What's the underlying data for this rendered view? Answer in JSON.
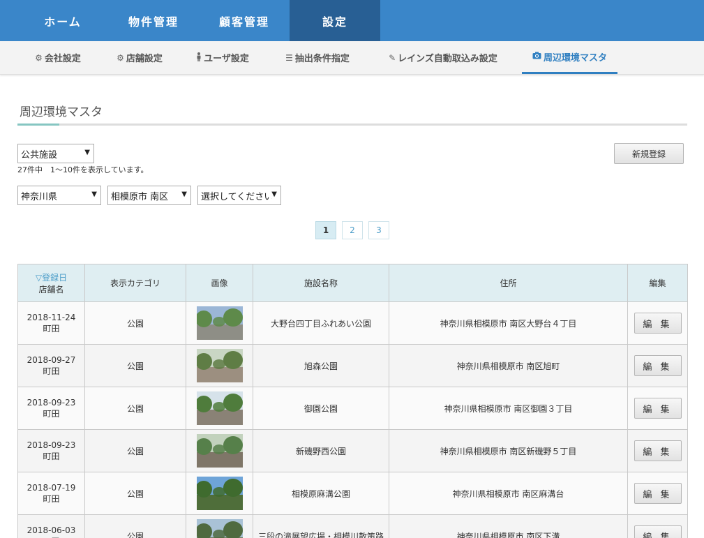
{
  "topnav": {
    "items": [
      {
        "label": "ホーム",
        "active": false
      },
      {
        "label": "物件管理",
        "active": false
      },
      {
        "label": "顧客管理",
        "active": false
      },
      {
        "label": "設定",
        "active": true
      }
    ]
  },
  "subnav": {
    "tabs": [
      {
        "icon": "gear-icon",
        "label": "会社設定"
      },
      {
        "icon": "gear-icon",
        "label": "店舗設定"
      },
      {
        "icon": "person-icon",
        "label": "ユーザ設定"
      },
      {
        "icon": "list-icon",
        "label": "抽出条件指定"
      },
      {
        "icon": "edit-icon",
        "label": "レインズ自動取込み設定"
      },
      {
        "icon": "camera-icon",
        "label": "周辺環境マスタ"
      }
    ]
  },
  "page": {
    "title": "周辺環境マスタ",
    "category_select": "公共施設",
    "count_text": "27件中　1〜10件を表示しています。",
    "new_button": "新規登録",
    "prefecture_select": "神奈川県",
    "city_select": "相模原市 南区",
    "area_select": "選択してください"
  },
  "pager": {
    "pages": [
      "1",
      "2",
      "3"
    ],
    "current": "1"
  },
  "table": {
    "headers": {
      "date_sort": "▽登録日",
      "store": "店舗名",
      "category": "表示カテゴリ",
      "image": "画像",
      "facility": "施設名称",
      "address": "住所",
      "edit": "編集"
    },
    "rows": [
      {
        "date": "2018-11-24",
        "store": "町田",
        "category": "公園",
        "facility": "大野台四丁目ふれあい公園",
        "address": "神奈川県相模原市 南区大野台４丁目",
        "edit": "編 集",
        "sky": "#9bb6d6",
        "ground": "#8e8e86",
        "green": "#5e8a4a"
      },
      {
        "date": "2018-09-27",
        "store": "町田",
        "category": "公園",
        "facility": "旭森公園",
        "address": "神奈川県相模原市 南区旭町",
        "edit": "編 集",
        "sky": "#c9d6c4",
        "ground": "#9c8f80",
        "green": "#5f7d45"
      },
      {
        "date": "2018-09-23",
        "store": "町田",
        "category": "公園",
        "facility": "御園公園",
        "address": "神奈川県相模原市 南区御園３丁目",
        "edit": "編 集",
        "sky": "#d6e2ea",
        "ground": "#8a8276",
        "green": "#4f7c3c"
      },
      {
        "date": "2018-09-23",
        "store": "町田",
        "category": "公園",
        "facility": "新磯野西公園",
        "address": "神奈川県相模原市 南区新磯野５丁目",
        "edit": "編 集",
        "sky": "#c2d2bd",
        "ground": "#7f7668",
        "green": "#56804a"
      },
      {
        "date": "2018-07-19",
        "store": "町田",
        "category": "公園",
        "facility": "相模原麻溝公園",
        "address": "神奈川県相模原市 南区麻溝台",
        "edit": "編 集",
        "sky": "#6ea4d8",
        "ground": "#4f6e3a",
        "green": "#3f6b2e"
      },
      {
        "date": "2018-06-03",
        "store": "町田",
        "category": "公園",
        "facility": "三段の滝展望広場・相模川散策路",
        "address": "神奈川県相模原市 南区下溝",
        "edit": "編 集",
        "sky": "#a9c2d6",
        "ground": "#6c7a5a",
        "green": "#4f6a3f"
      }
    ]
  }
}
